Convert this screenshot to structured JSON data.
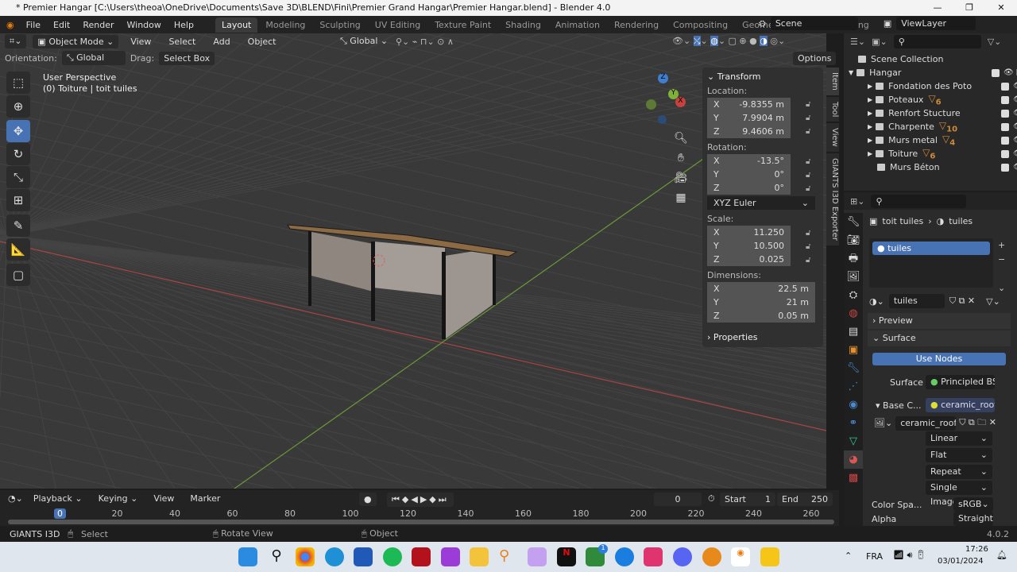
{
  "window": {
    "title": "* Premier Hangar [C:\\Users\\theoa\\OneDrive\\Documents\\Save 3D\\BLEND\\Fini\\Premier Grand Hangar\\Premier Hangar.blend] - Blender 4.0",
    "minimize": "—",
    "maximize": "❐",
    "close": "✕"
  },
  "menu": [
    "File",
    "Edit",
    "Render",
    "Window",
    "Help"
  ],
  "workspaces": [
    "Layout",
    "Modeling",
    "Sculpting",
    "UV Editing",
    "Texture Paint",
    "Shading",
    "Animation",
    "Rendering",
    "Compositing",
    "Geometry Nodes",
    "Scripting"
  ],
  "add_workspace": "+",
  "scene": {
    "name": "Scene",
    "view_layer": "ViewLayer"
  },
  "viewport_header": {
    "mode": "Object Mode",
    "menus": [
      "View",
      "Select",
      "Add",
      "Object"
    ],
    "transform_orientation": "Global"
  },
  "tool_settings": {
    "orientation_label": "Orientation:",
    "orientation": "Global",
    "drag_label": "Drag:",
    "drag": "Select Box",
    "options": "Options"
  },
  "viewport": {
    "perspective": "User Perspective",
    "object_info": "(0) Toiture | toit tuiles",
    "gizmo": {
      "x": "X",
      "y": "Y",
      "z": "Z"
    }
  },
  "npanel": {
    "title": "Transform",
    "location_label": "Location:",
    "location": {
      "x": "-9.8355 m",
      "y": "7.9904 m",
      "z": "9.4606 m"
    },
    "rotation_label": "Rotation:",
    "rotation": {
      "x": "-13.5°",
      "y": "0°",
      "z": "0°"
    },
    "rotation_mode": "XYZ Euler",
    "scale_label": "Scale:",
    "scale": {
      "x": "11.250",
      "y": "10.500",
      "z": "0.025"
    },
    "dimensions_label": "Dimensions:",
    "dimensions": {
      "x": "22.5 m",
      "y": "21 m",
      "z": "0.05 m"
    },
    "properties": "Properties",
    "axis": {
      "x": "X",
      "y": "Y",
      "z": "Z"
    }
  },
  "side_tabs": [
    "Item",
    "Tool",
    "View",
    "GIANTS I3D Exporter"
  ],
  "outliner": {
    "root": "Scene Collection",
    "collection": "Hangar",
    "items": [
      {
        "name": "Fondation des Poto",
        "badge": ""
      },
      {
        "name": "Poteaux",
        "badge": "6"
      },
      {
        "name": "Renfort Stucture",
        "badge": ""
      },
      {
        "name": "Charpente",
        "badge": "10"
      },
      {
        "name": "Murs metal",
        "badge": "4"
      },
      {
        "name": "Toiture",
        "badge": "6"
      },
      {
        "name": "Murs Béton",
        "badge": ""
      }
    ]
  },
  "properties": {
    "object": "toit tuiles",
    "material": "tuiles",
    "slot": "tuiles",
    "material_field": "tuiles",
    "preview": "Preview",
    "surface_panel": "Surface",
    "use_nodes": "Use Nodes",
    "surface_label": "Surface",
    "surface_value": "Principled BSDF",
    "base_color_label": "Base C...",
    "base_color_value": "ceramic_roof_...",
    "image": "ceramic_roof...",
    "interpolation": "Linear",
    "projection": "Flat",
    "extension": "Repeat",
    "source": "Single Image",
    "color_space_label": "Color Spa...",
    "color_space": "sRGB",
    "alpha_label": "Alpha",
    "alpha": "Straight"
  },
  "timeline": {
    "menus": [
      "Playback",
      "Keying",
      "View",
      "Marker"
    ],
    "current_frame": "0",
    "start_label": "Start",
    "start": "1",
    "end_label": "End",
    "end": "250",
    "ticks": [
      "0",
      "20",
      "40",
      "60",
      "80",
      "100",
      "120",
      "140",
      "160",
      "180",
      "200",
      "220",
      "240",
      "260"
    ]
  },
  "status": {
    "addon": "GIANTS I3D",
    "left": "Select",
    "middle": "Rotate View",
    "right": "Object",
    "version": "4.0.2"
  },
  "taskbar": {
    "lang": "FRA",
    "time": "17:26",
    "date": "03/01/2024",
    "xbox_badge": "1"
  },
  "colors": {
    "accent": "#4772b3",
    "x_axis": "#c8413f",
    "y_axis": "#7fb03a",
    "z_axis": "#3f7fd0"
  }
}
